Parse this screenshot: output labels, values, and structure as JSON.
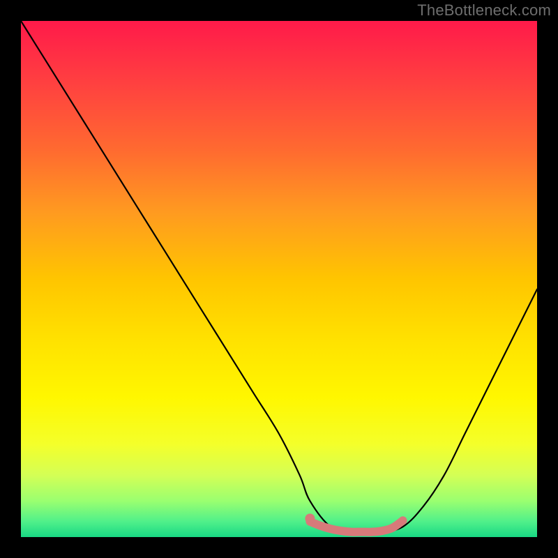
{
  "watermark": "TheBottleneck.com",
  "chart_data": {
    "type": "line",
    "title": "",
    "xlabel": "",
    "ylabel": "",
    "xlim": [
      0,
      100
    ],
    "ylim": [
      0,
      100
    ],
    "series": [
      {
        "name": "bottleneck-curve",
        "color": "#000000",
        "x": [
          0,
          5,
          10,
          15,
          20,
          25,
          30,
          35,
          40,
          45,
          50,
          54,
          56,
          60,
          64,
          68,
          70,
          74,
          78,
          82,
          86,
          90,
          94,
          100
        ],
        "y": [
          100,
          92,
          84,
          76,
          68,
          60,
          52,
          44,
          36,
          28,
          20,
          12,
          7,
          2,
          1,
          1,
          1,
          2,
          6,
          12,
          20,
          28,
          36,
          48
        ]
      }
    ],
    "highlight": {
      "name": "optimal-range",
      "color": "#d77a7a",
      "x": [
        56,
        58,
        60,
        62,
        64,
        66,
        68,
        70,
        72,
        74
      ],
      "y": [
        3.0,
        2.2,
        1.6,
        1.2,
        1.0,
        1.0,
        1.0,
        1.2,
        1.8,
        3.2
      ]
    },
    "highlight_point": {
      "name": "optimal-start-marker",
      "color": "#d77a7a",
      "x": 56,
      "y": 3.6
    },
    "background_gradient": {
      "top_color": "#ff1a4a",
      "mid_color": "#ffe200",
      "bottom_color": "#18d884"
    }
  }
}
